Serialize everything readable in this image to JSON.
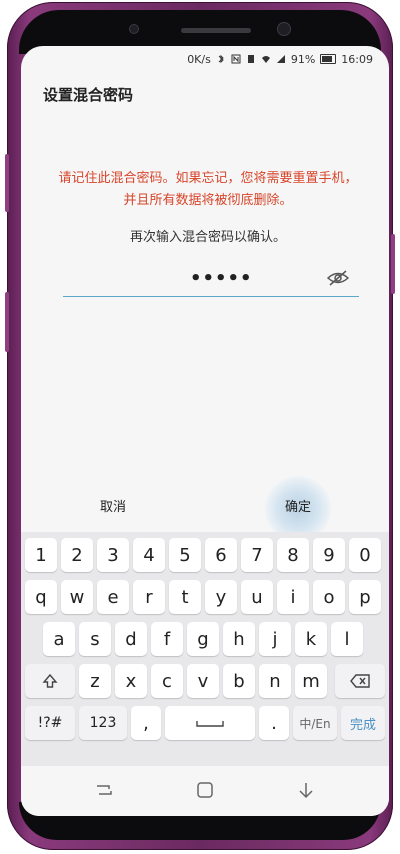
{
  "status_bar": {
    "net_speed": "0K/s",
    "battery_percent": "91%",
    "time": "16:09"
  },
  "title": "设置混合密码",
  "warning_line1": "请记住此混合密码。如果忘记，您将需要重置手机，",
  "warning_line2": "并且所有数据将被彻底删除。",
  "instruction": "再次输入混合密码以确认。",
  "password_masked": "•••••",
  "actions": {
    "cancel": "取消",
    "confirm": "确定"
  },
  "keyboard": {
    "number_row": [
      "1",
      "2",
      "3",
      "4",
      "5",
      "6",
      "7",
      "8",
      "9",
      "0"
    ],
    "row1": [
      "q",
      "w",
      "e",
      "r",
      "t",
      "y",
      "u",
      "i",
      "o",
      "p"
    ],
    "row2": [
      "a",
      "s",
      "d",
      "f",
      "g",
      "h",
      "j",
      "k",
      "l"
    ],
    "row3": [
      "z",
      "x",
      "c",
      "v",
      "b",
      "n",
      "m"
    ],
    "symbols_key": "!?#",
    "numbers_key": "123",
    "comma_key": ",",
    "period_key": ".",
    "lang_key": "中/En",
    "done_key": "完成",
    "row1_hints": [
      "",
      "",
      "",
      "",
      "",
      "",
      "",
      "",
      "",
      ""
    ],
    "row2_hints": [
      "",
      "",
      "",
      "",
      "",
      "",
      "",
      "",
      "",
      ""
    ]
  },
  "colors": {
    "warning": "#d7452b",
    "accent": "#5ba7c8",
    "phone_frame": "#7a3470"
  },
  "icons": [
    "bluetooth-icon",
    "nfc-icon",
    "sim-icon",
    "wifi-icon",
    "signal-icon",
    "battery-icon",
    "eye-icon",
    "shift-icon",
    "backspace-icon",
    "recent-apps-icon",
    "home-icon",
    "back-icon"
  ]
}
